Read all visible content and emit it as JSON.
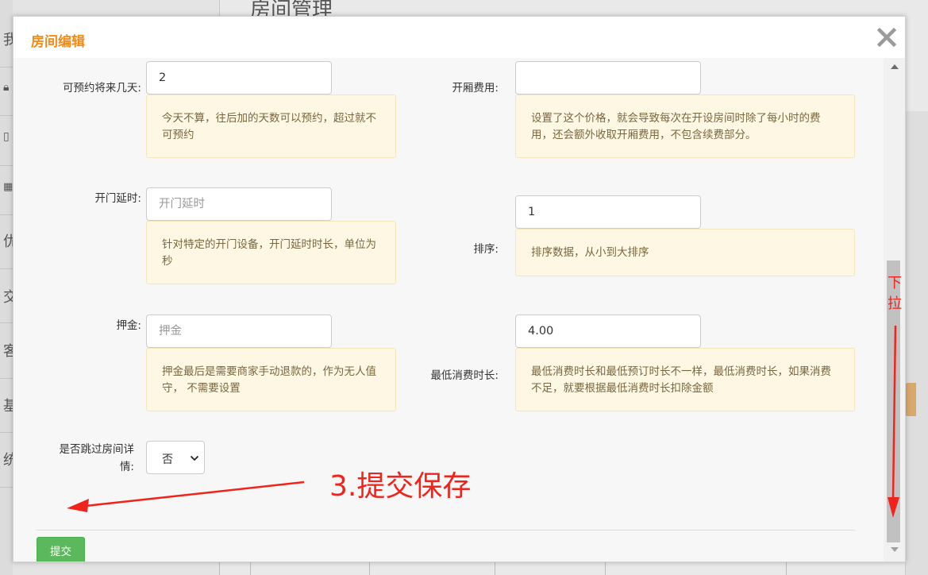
{
  "background": {
    "page_title": "房间管理",
    "sidebar_chars": [
      "我",
      "",
      "",
      "",
      "优",
      "交",
      "客",
      "基",
      "统"
    ]
  },
  "dialog": {
    "title": "房间编辑",
    "close_icon": "close-icon"
  },
  "form": {
    "booking_days": {
      "label": "可预约将来几天:",
      "value": "2",
      "hint": "今天不算，往后加的天数可以预约，超过就不可预约"
    },
    "room_opening_fee": {
      "label": "开厢费用:",
      "value": "",
      "hint": "设置了这个价格，就会导致每次在开设房间时除了每小时的费用，还会额外收取开厢费用，不包含续费部分。"
    },
    "door_delay": {
      "label": "开门延时:",
      "value": "",
      "placeholder": "开门延时",
      "hint": "针对特定的开门设备，开门延时时长，单位为秒"
    },
    "sort_order": {
      "label": "排序:",
      "value": "1",
      "hint": "排序数据，从小到大排序"
    },
    "deposit": {
      "label": "押金:",
      "value": "",
      "placeholder": "押金",
      "hint": "押金最后是需要商家手动退款的，作为无人值守， 不需要设置"
    },
    "min_duration": {
      "label": "最低消费时长:",
      "value": "4.00",
      "hint": "最低消费时长和最低预订时长不一样，最低消费时长，如果消费不足，就要根据最低消费时长扣除金额"
    },
    "skip_detail": {
      "label": "是否跳过房间详情:",
      "selected": "否"
    },
    "submit_label": "提交"
  },
  "annotations": {
    "step_text": "3.提交保存",
    "side_text": "下拉"
  },
  "colors": {
    "title_orange": "#f28a1a",
    "submit_green": "#5cb85c",
    "annotation_red": "#f0241c",
    "hint_bg": "#fdf7e3"
  }
}
